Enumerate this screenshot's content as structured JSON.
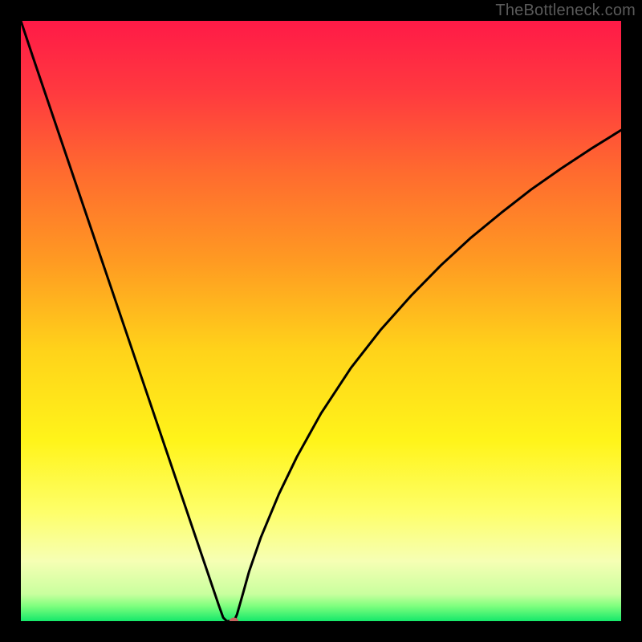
{
  "watermark": "TheBottleneck.com",
  "chart_data": {
    "type": "line",
    "title": "",
    "xlabel": "",
    "ylabel": "",
    "xlim": [
      0,
      100
    ],
    "ylim": [
      0,
      100
    ],
    "grid": false,
    "annotations": [],
    "gradient_stops": [
      {
        "offset": 0.0,
        "color": "#ff1a47"
      },
      {
        "offset": 0.12,
        "color": "#ff3a3f"
      },
      {
        "offset": 0.25,
        "color": "#ff6a2f"
      },
      {
        "offset": 0.4,
        "color": "#ff9a22"
      },
      {
        "offset": 0.55,
        "color": "#ffd31a"
      },
      {
        "offset": 0.7,
        "color": "#fff41a"
      },
      {
        "offset": 0.82,
        "color": "#feff6b"
      },
      {
        "offset": 0.9,
        "color": "#f6ffb4"
      },
      {
        "offset": 0.955,
        "color": "#c9ff9e"
      },
      {
        "offset": 0.975,
        "color": "#7eff7e"
      },
      {
        "offset": 1.0,
        "color": "#15e86a"
      }
    ],
    "series": [
      {
        "name": "bottleneck-curve",
        "x": [
          0,
          2,
          4,
          6,
          8,
          10,
          12,
          14,
          16,
          18,
          20,
          22,
          24,
          26,
          28,
          30,
          31,
          32,
          33,
          33.7,
          34.3,
          35,
          35.5,
          36,
          37,
          38,
          40,
          43,
          46,
          50,
          55,
          60,
          65,
          70,
          75,
          80,
          85,
          90,
          95,
          100
        ],
        "y": [
          100,
          94,
          88.1,
          82.2,
          76.3,
          70.4,
          64.5,
          58.6,
          52.7,
          46.8,
          40.9,
          35,
          29.1,
          23.2,
          17.3,
          11.4,
          8.45,
          5.5,
          2.55,
          0.6,
          0.0,
          0.0,
          0.0,
          1.1,
          4.6,
          8.2,
          14.0,
          21.2,
          27.4,
          34.6,
          42.2,
          48.6,
          54.2,
          59.3,
          63.9,
          68.0,
          71.9,
          75.4,
          78.7,
          81.8
        ]
      }
    ],
    "marker": {
      "x": 35.5,
      "y": 0.0,
      "color": "#c7625e"
    },
    "curve_color": "#000000",
    "curve_width": 3
  }
}
